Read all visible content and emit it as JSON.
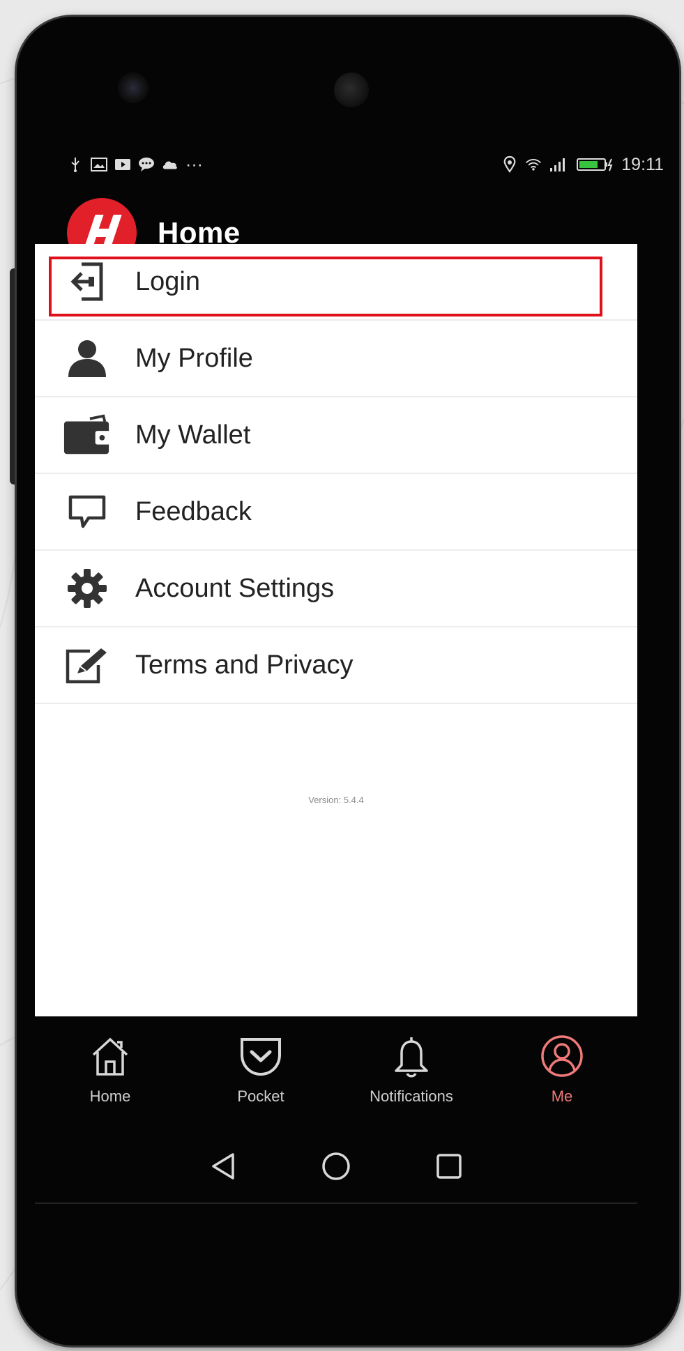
{
  "status": {
    "time": "19:11",
    "left_icons": [
      "usb-icon",
      "gallery-icon",
      "video-icon",
      "chat-icon",
      "cloud-icon"
    ],
    "more": "···"
  },
  "header": {
    "title": "Home",
    "logo_letter": "H",
    "brand_color": "#e2202a"
  },
  "menu": {
    "items": [
      {
        "label": "Login",
        "icon": "login-icon"
      },
      {
        "label": "My Profile",
        "icon": "person-icon"
      },
      {
        "label": "My Wallet",
        "icon": "wallet-icon"
      },
      {
        "label": "Feedback",
        "icon": "chat-bubble-icon"
      },
      {
        "label": "Account Settings",
        "icon": "gear-icon"
      },
      {
        "label": "Terms and Privacy",
        "icon": "edit-icon"
      }
    ],
    "highlight_color": "#e0101a"
  },
  "version": "Version: 5.4.4",
  "bottom_nav": {
    "items": [
      {
        "label": "Home",
        "icon": "home-icon",
        "active": false
      },
      {
        "label": "Pocket",
        "icon": "pocket-icon",
        "active": false
      },
      {
        "label": "Notifications",
        "icon": "bell-icon",
        "active": false
      },
      {
        "label": "Me",
        "icon": "user-circle-icon",
        "active": true
      }
    ],
    "active_color": "#f07a7a"
  }
}
